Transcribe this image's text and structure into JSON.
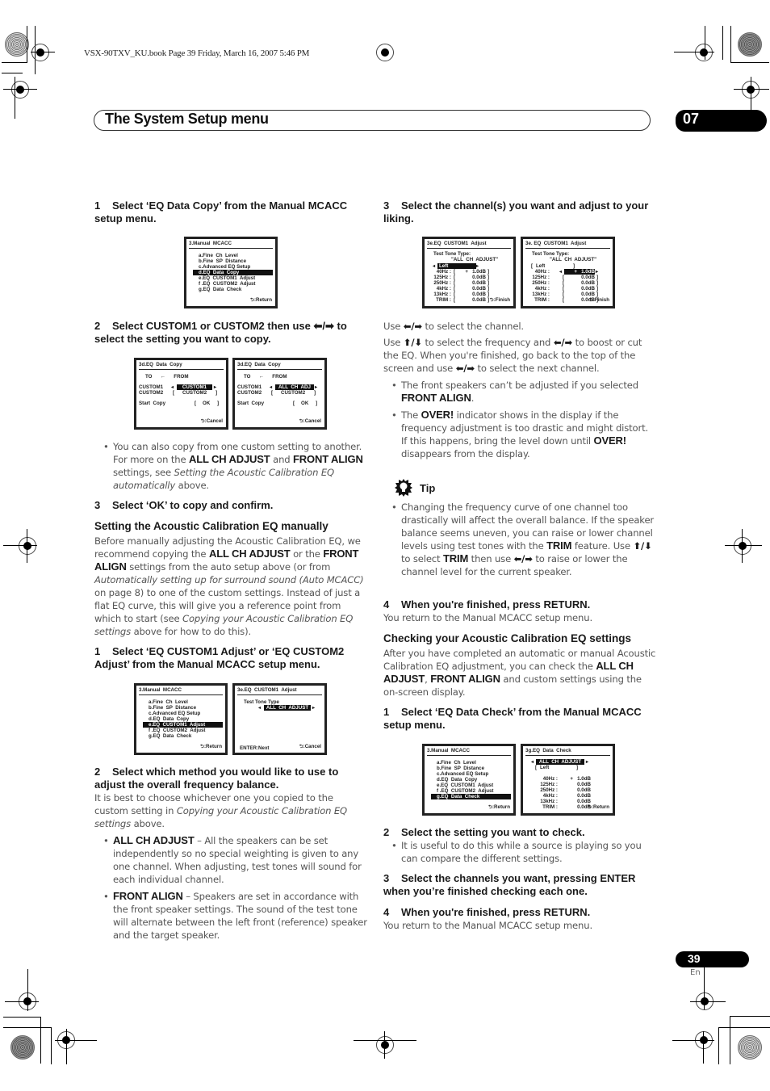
{
  "print_info": "VSX-90TXV_KU.book  Page 39  Friday, March 16, 2007  5:46 PM",
  "header": {
    "title": "The System Setup menu",
    "chapter": "07"
  },
  "footer": {
    "page": "39",
    "lang": "En"
  },
  "left": {
    "step1": {
      "n": "1",
      "text": "Select ‘EQ Data Copy’ from the Manual MCACC setup menu."
    },
    "step2": {
      "n": "2",
      "text_a": "Select CUSTOM1 or CUSTOM2 then use",
      "arrows": "⬅/➡",
      "text_b": "to select the setting you want to copy."
    },
    "bullet1": {
      "a": "You can also copy from one custom setting to another. For more on the ",
      "b1": "ALL CH ADJUST",
      "c": " and ",
      "b2": "FRONT ALIGN",
      "d": " settings, see ",
      "i": "Setting the Acoustic Calibration EQ automatically",
      "e": " above."
    },
    "step3": {
      "n": "3",
      "text": "Select ‘OK’ to copy and confirm."
    },
    "section1": {
      "title": "Setting the Acoustic Calibration EQ manually",
      "p_a": "Before manually adjusting the Acoustic Calibration EQ, we recommend copying the ",
      "b1": "ALL CH ADJUST",
      "p_b": " or the ",
      "b2": "FRONT ALIGN",
      "p_c": " settings from the auto setup above (or from ",
      "i1": "Automatically setting up for surround sound (Auto MCACC)",
      "p_d": " on page 8) to one of the custom settings. Instead of just a flat EQ curve, this will give you a reference point from which to start (see ",
      "i2": "Copying your Acoustic Calibration EQ settings",
      "p_e": " above for how to do this)."
    },
    "m_step1": {
      "n": "1",
      "text": "Select ‘EQ CUSTOM1 Adjust’ or ‘EQ CUSTOM2 Adjust’ from the Manual MCACC setup menu."
    },
    "m_step2": {
      "n": "2",
      "text": "Select which method you would like to use to adjust the overall frequency balance.",
      "p_a": "It is best to choose whichever one you copied to the custom setting in ",
      "i": "Copying your Acoustic Calibration EQ settings",
      "p_b": " above."
    },
    "bullet_all": {
      "b": "ALL CH ADJUST",
      "text": " – All the speakers can be set independently so no special weighting is given to any one channel. When adjusting, test tones will sound for each individual channel."
    },
    "bullet_front": {
      "b": "FRONT ALIGN",
      "text": " – Speakers are set in accordance with the front speaker settings. The sound of the test tone will alternate between the left front (reference) speaker and the target speaker."
    }
  },
  "right": {
    "step3": {
      "n": "3",
      "text": "Select the channel(s) you want and adjust to your liking."
    },
    "use1": {
      "a": "Use ",
      "arrows": "⬅/➡",
      "b": " to select the channel."
    },
    "use2": {
      "a": "Use ",
      "arrows1": "⬆/⬇",
      "b": " to select the frequency and ",
      "arrows2": "⬅/➡",
      "c": " to boost or cut the EQ. When you're finished, go back to the top of the screen and use ",
      "arrows3": "⬅/➡",
      "d": " to select the next channel."
    },
    "bullet1": {
      "a": "The front speakers can’t be adjusted if you selected ",
      "b": "FRONT ALIGN",
      "c": "."
    },
    "bullet2": {
      "a": "The ",
      "b1": "OVER!",
      "c": " indicator shows in the display if the frequency adjustment is too drastic and might distort. If this happens, bring the level down until ",
      "b2": "OVER!",
      "d": " disappears from the display."
    },
    "tip": {
      "label": "Tip",
      "a": "Changing the frequency curve of one channel too drastically will affect the overall balance. If the speaker balance seems uneven, you can raise or lower channel levels using test tones with the ",
      "b1": "TRIM",
      "c": " feature. Use ",
      "arrows1": "⬆/⬇",
      "d": " to select ",
      "b2": "TRIM",
      "e": " then use ",
      "arrows2": "⬅/➡",
      "f": " to raise or lower the channel level for the current speaker."
    },
    "step4": {
      "n": "4",
      "text": "When you're finished, press RETURN.",
      "p": "You return to the Manual MCACC setup menu."
    },
    "section2": {
      "title": "Checking your Acoustic Calibration EQ settings",
      "p_a": "After you have completed an automatic or manual Acoustic Calibration EQ adjustment, you can check the ",
      "b1": "ALL CH ADJUST",
      "p_b": ", ",
      "b2": "FRONT ALIGN",
      "p_c": " and custom settings using the on-screen display."
    },
    "c_step1": {
      "n": "1",
      "text": "Select ‘EQ Data Check’ from the Manual MCACC setup menu."
    },
    "c_step2": {
      "n": "2",
      "text": "Select the setting you want to check.",
      "bullet": "It is useful to do this while a source is playing so you can compare the different settings."
    },
    "c_step3": {
      "n": "3",
      "text": "Select the channels you want, pressing ENTER when you’re finished checking each one."
    },
    "c_step4": {
      "n": "4",
      "text": "When you're finished, press RETURN.",
      "p": "You return to the Manual MCACC setup menu."
    }
  },
  "osd": {
    "manual_menu": {
      "title": "3.Manual  MCACC",
      "items": [
        "a.Fine  Ch  Level",
        "b.Fine  SP  Distance",
        "c.Advanced EQ Setup",
        "d.EQ  Data  Copy",
        "e.EQ  CUSTOM1  Adjust",
        "f .EQ  CUSTOM2  Adjust",
        "g.EQ  Data  Check"
      ],
      "footer": "⮌:Return"
    },
    "copy_a": {
      "title": "3d.EQ  Data  Copy",
      "header": "TO      ←      FROM",
      "row1_label": "CUSTOM1",
      "row1_value": "CUSTOM1",
      "row2_label": "CUSTOM2",
      "row2_value": "CUSTOM2",
      "start_label": "Start  Copy",
      "start_value": "OK",
      "footer": "⮌:Cancel"
    },
    "copy_b": {
      "title": "3d.EQ  Data  Copy",
      "header": "TO      ←      FROM",
      "row1_label": "CUSTOM1",
      "row1_value": "ALL  CH  ADJ",
      "row2_label": "CUSTOM2",
      "row2_value": "CUSTOM2",
      "start_label": "Start  Copy",
      "start_value": "OK",
      "footer": "⮌:Cancel"
    },
    "adjust_a": {
      "title": "3e.EQ  CUSTOM1  Adjust",
      "tone_label": "Test Tone Type:",
      "tone_value": "\"ALL  CH  ADJUST\"",
      "channel": "Left",
      "rows": [
        {
          "f": "40Hz :",
          "v": "+   1.0dB"
        },
        {
          "f": "125Hz :",
          "v": "0.0dB"
        },
        {
          "f": "250Hz :",
          "v": "0.0dB"
        },
        {
          "f": "4kHz :",
          "v": "0.0dB"
        },
        {
          "f": "13kHz :",
          "v": "0.0dB"
        },
        {
          "f": "TRIM :",
          "v": "0.0dB"
        }
      ],
      "footer": "⮌:Finish"
    },
    "adjust_b": {
      "title": "3e. EQ  CUSTOM1  Adjust",
      "tone_label": "Test Tone Type:",
      "tone_value": "\"ALL  CH  ADJUST\"",
      "channel": "Left",
      "rows": [
        {
          "f": "40Hz :",
          "v": "+   1.0dB"
        },
        {
          "f": "125Hz :",
          "v": "0.0dB"
        },
        {
          "f": "250Hz :",
          "v": "0.0dB"
        },
        {
          "f": "4kHz :",
          "v": "0.0dB"
        },
        {
          "f": "13kHz :",
          "v": "0.0dB"
        },
        {
          "f": "TRIM :",
          "v": "0.0dB"
        }
      ],
      "footer": "⮌:Finish"
    },
    "adjust_type": {
      "title": "3e.EQ  CUSTOM1  Adjust",
      "tone_label": "Test Tone Type",
      "tone_value": "ALL  CH  ADJUST",
      "footer_left": "ENTER:Next",
      "footer": "⮌:Cancel"
    },
    "check": {
      "title": "3g.EQ  Data  Check",
      "setting": "ALL  CH  ADJUST",
      "channel": "Left",
      "rows": [
        {
          "f": "40Hz :",
          "v": "+   1.0dB"
        },
        {
          "f": "125Hz :",
          "v": "0.0dB"
        },
        {
          "f": "250Hz :",
          "v": "0.0dB"
        },
        {
          "f": "4kHz :",
          "v": "0.0dB"
        },
        {
          "f": "13kHz :",
          "v": "0.0dB"
        },
        {
          "f": "TRIM :",
          "v": "0.0dB"
        }
      ],
      "footer": "⮌:Return"
    }
  }
}
